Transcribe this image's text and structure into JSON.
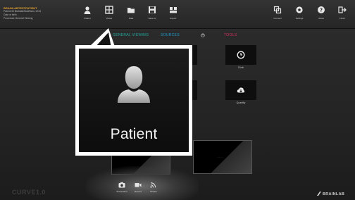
{
  "patient_info": {
    "name": "BRAINLABTESTPATIENT",
    "lines": [
      "Patient ID  Brainlab/Nod/Nam, 1234",
      "Date of birth",
      "Procedure   General Viewing"
    ]
  },
  "toolbar": {
    "left": [
      {
        "label": "Patient",
        "icon": "person-icon"
      },
      {
        "label": "Viewer",
        "icon": "viewer-icon"
      },
      {
        "label": "Data",
        "icon": "folder-icon"
      },
      {
        "label": "Save As",
        "icon": "save-icon"
      },
      {
        "label": "Export",
        "icon": "export-icon"
      }
    ],
    "right": [
      {
        "label": "Connect",
        "icon": "connect-icon"
      },
      {
        "label": "Settings",
        "icon": "gear-icon"
      },
      {
        "label": "About",
        "icon": "help-icon"
      },
      {
        "label": "Finish",
        "icon": "finish-icon"
      }
    ]
  },
  "tabs": [
    {
      "label": "GENERAL VIEWING",
      "color": "#1fa9a0"
    },
    {
      "label": "SOURCES",
      "color": "#1c9ad0"
    },
    {
      "label": "TOOLS",
      "color": "#d0335a"
    }
  ],
  "tiles": [
    {
      "label": "Clock",
      "icon": "clock-icon"
    },
    {
      "label": "Quantity",
      "icon": "cloud-download-icon"
    }
  ],
  "dock": [
    {
      "label": "Screenshot",
      "icon": "camera-icon"
    },
    {
      "label": "Record",
      "icon": "video-icon"
    },
    {
      "label": "Stream",
      "icon": "stream-icon"
    }
  ],
  "callout": {
    "label": "Patient",
    "icon": "person-icon"
  },
  "branding": {
    "product": "CURVE1.0",
    "company": "BRAINLAB"
  }
}
